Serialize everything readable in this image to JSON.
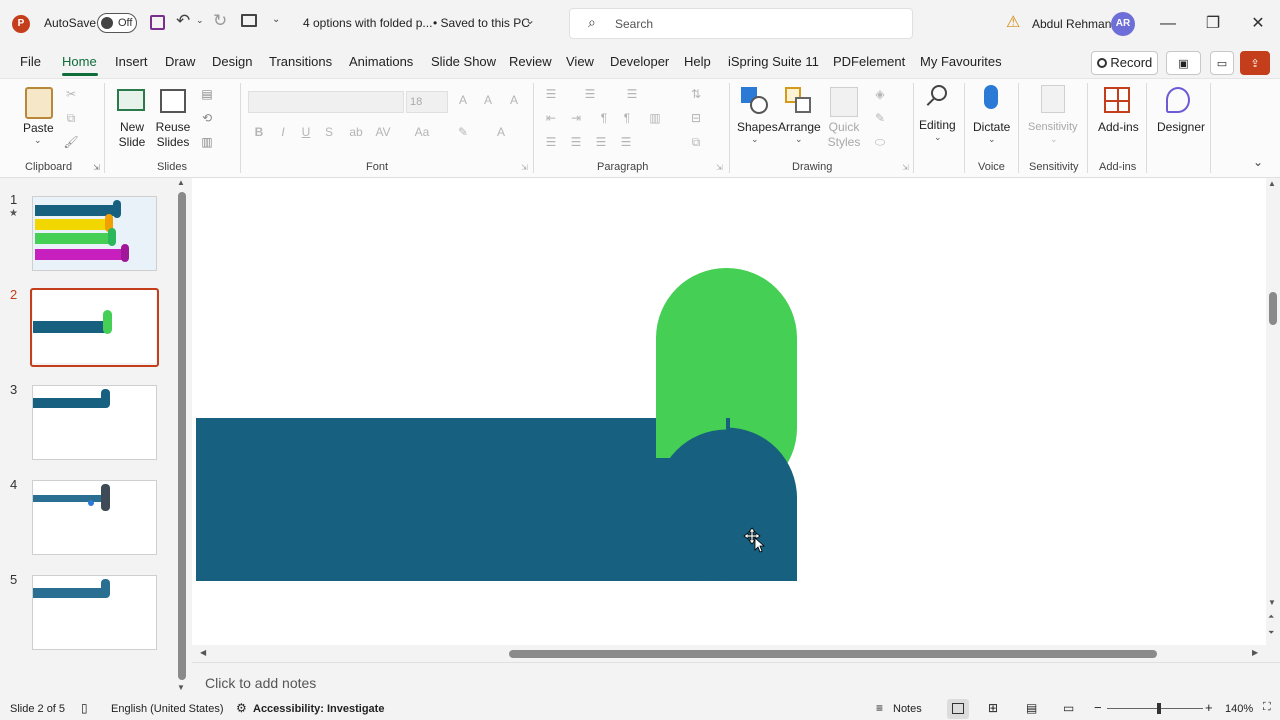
{
  "titlebar": {
    "autosave_label": "AutoSave",
    "autosave_state": "Off",
    "doc_title": "4 options with folded p...",
    "saved_status": "• Saved to this PC",
    "search_placeholder": "Search",
    "user_name": "Abdul Rehman",
    "user_initials": "AR"
  },
  "menu": {
    "tabs": [
      "File",
      "Home",
      "Insert",
      "Draw",
      "Design",
      "Transitions",
      "Animations",
      "Slide Show",
      "Review",
      "View",
      "Developer",
      "Help",
      "iSpring Suite 11",
      "PDFelement",
      "My Favourites"
    ],
    "active_tab": "Home",
    "record_label": "Record"
  },
  "ribbon": {
    "groups": {
      "clipboard": "Clipboard",
      "slides": "Slides",
      "font": "Font",
      "paragraph": "Paragraph",
      "drawing": "Drawing",
      "voice": "Voice",
      "sensitivity": "Sensitivity",
      "addins": "Add-ins"
    },
    "paste": "Paste",
    "new_slide_1": "New",
    "new_slide_2": "Slide",
    "reuse_slides_1": "Reuse",
    "reuse_slides_2": "Slides",
    "font_size": "18",
    "shapes": "Shapes",
    "arrange": "Arrange",
    "quick_styles_1": "Quick",
    "quick_styles_2": "Styles",
    "editing": "Editing",
    "dictate": "Dictate",
    "sensitivity_btn": "Sensitivity",
    "addins_btn": "Add-ins",
    "designer": "Designer"
  },
  "thumbnails": [
    {
      "number": "1",
      "marker": "★"
    },
    {
      "number": "2",
      "selected": true
    },
    {
      "number": "3"
    },
    {
      "number": "4"
    },
    {
      "number": "5"
    }
  ],
  "notes_placeholder": "Click to add notes",
  "status": {
    "slide_info": "Slide 2 of 5",
    "language": "English (United States)",
    "accessibility": "Accessibility: Investigate",
    "notes": "Notes",
    "zoom": "140%"
  },
  "colors": {
    "accent": "#0f6d3a",
    "selection": "#c43e1c",
    "shape_blue": "#17607f",
    "shape_green": "#45cf55"
  }
}
